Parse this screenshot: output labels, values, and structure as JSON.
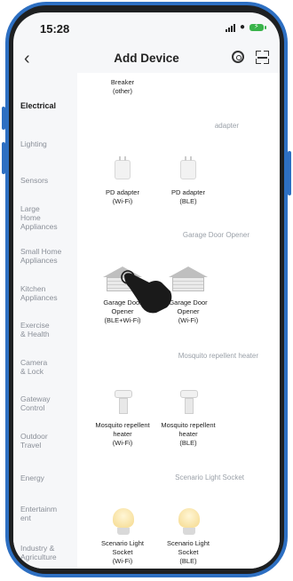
{
  "status_bar": {
    "time": "15:28"
  },
  "header": {
    "title": "Add Device",
    "back_symbol": "‹"
  },
  "sidebar": {
    "items": [
      {
        "label": "Electrical",
        "active": true
      },
      {
        "label": "Lighting"
      },
      {
        "label": "Sensors"
      },
      {
        "label": "Large\nHome\nAppliances"
      },
      {
        "label": "Small Home\nAppliances"
      },
      {
        "label": "Kitchen\nAppliances"
      },
      {
        "label": "Exercise\n& Health"
      },
      {
        "label": "Camera\n& Lock"
      },
      {
        "label": "Gateway\nControl"
      },
      {
        "label": "Outdoor\nTravel"
      },
      {
        "label": "Energy"
      },
      {
        "label": "Entertainm\nent"
      },
      {
        "label": "Industry &\nAgriculture"
      }
    ]
  },
  "content": {
    "breaker": {
      "label": "Breaker\n(other)"
    },
    "categories": {
      "adapter": "adapter",
      "garage": "Garage Door Opener",
      "mosquito": "Mosquito repellent heater",
      "scenario": "Scenario Light Socket"
    },
    "devices": {
      "pd_wifi": "PD adapter\n(Wi-Fi)",
      "pd_ble": "PD adapter\n(BLE)",
      "garage_ble": "Garage Door\nOpener\n(BLE+Wi-Fi)",
      "garage_wifi": "Garage Door\nOpener\n(Wi-Fi)",
      "mosq_wifi": "Mosquito repellent\nheater\n(Wi-Fi)",
      "mosq_ble": "Mosquito repellent\nheater\n(BLE)",
      "scenario_wifi": "Scenario Light\nSocket\n(Wi-Fi)",
      "scenario_ble": "Scenario Light\nSocket\n(BLE)"
    }
  },
  "colors": {
    "frame": "#2d6fc2",
    "battery": "#39b34a"
  },
  "icons": [
    "back-chevron-icon",
    "scan-icon",
    "qr-scan-icon",
    "pointing-hand-icon"
  ]
}
